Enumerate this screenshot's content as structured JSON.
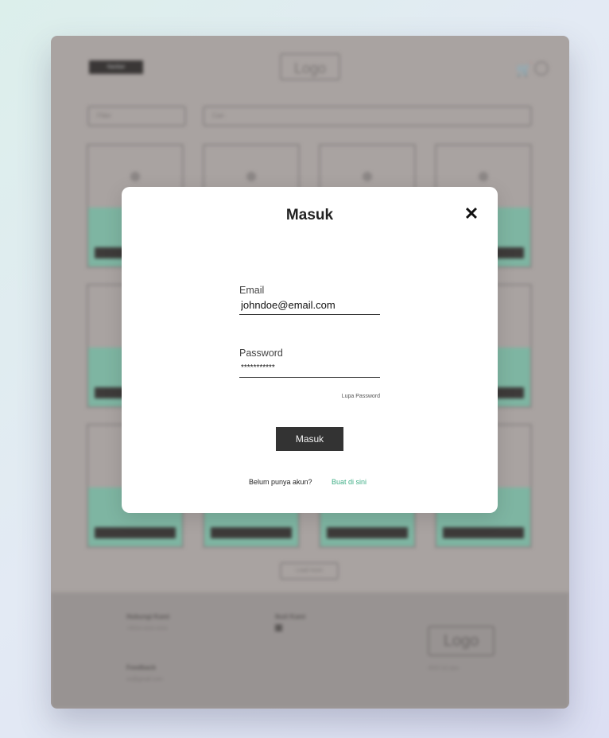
{
  "background": {
    "header": {
      "badge": "Navbar",
      "logo": "Logo"
    },
    "filter_placeholder": "Filter",
    "search_placeholder": "Cari",
    "load_more": "Load more",
    "footer": {
      "contact_title": "Hubungi Kami",
      "contact_phone": "+62xx-xxxx-xxxx",
      "follow_title": "Ikuti Kami",
      "feedback_title": "Feedback",
      "feedback_email": "xx@gmail.com",
      "logo": "Logo",
      "copyright": "2022 (c) quu"
    }
  },
  "modal": {
    "title": "Masuk",
    "close_icon": "close-icon",
    "email_label": "Email",
    "email_value": "johndoe@email.com",
    "password_label": "Password",
    "password_value": "***********",
    "forgot_label": "Lupa Password",
    "submit_label": "Masuk",
    "signup_prompt": "Belum punya akun?",
    "signup_link": "Buat di sini"
  },
  "colors": {
    "accent": "#3fae86",
    "button": "#333333",
    "overlay": "#a9a3a1",
    "card_green": "#7eb5a2"
  }
}
